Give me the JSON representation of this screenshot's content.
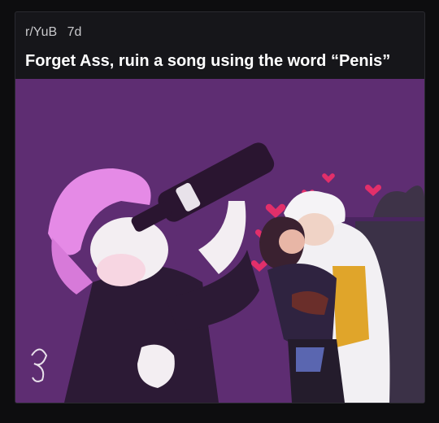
{
  "post": {
    "subreddit": "r/YuB",
    "age": "7d",
    "title": "Forget Ass, ruin a song using the word “Penis”"
  },
  "image": {
    "kind": "cartoon-illustration"
  },
  "colors": {
    "page_bg": "#0d0d0f",
    "card_bg": "#16161a",
    "title_text": "#ffffff",
    "meta_text": "#c9c9cc",
    "art_bg": "#5e2d72"
  }
}
